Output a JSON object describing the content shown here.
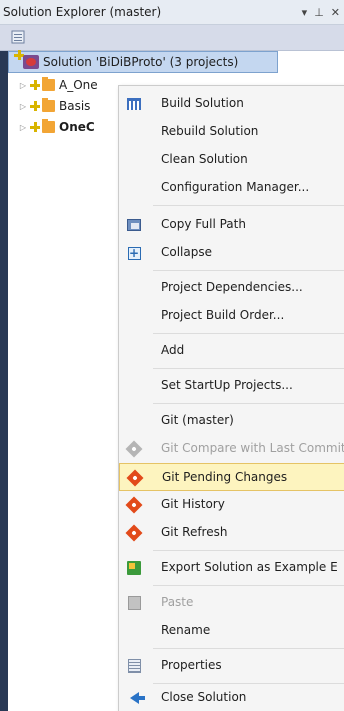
{
  "window": {
    "title": "Solution Explorer (master)",
    "pin_glyph": "▾ ⊥ ✕"
  },
  "toolbar": {
    "icon": "properties-icon"
  },
  "tree": {
    "solution_label": "Solution 'BiDiBProto' (3 projects)",
    "items": [
      {
        "label": "A_One"
      },
      {
        "label": "Basis"
      },
      {
        "label": "OneC"
      }
    ]
  },
  "menu": {
    "items": [
      {
        "label": "Build Solution",
        "icon": "build-icon"
      },
      {
        "label": "Rebuild Solution"
      },
      {
        "label": "Clean Solution"
      },
      {
        "label": "Configuration Manager..."
      },
      {
        "label": "Copy Full Path",
        "icon": "copy-icon"
      },
      {
        "label": "Collapse",
        "icon": "collapse-icon"
      },
      {
        "label": "Project Dependencies..."
      },
      {
        "label": "Project Build Order..."
      },
      {
        "label": "Add"
      },
      {
        "label": "Set StartUp Projects..."
      },
      {
        "label": "Git (master)"
      },
      {
        "label": "Git Compare with Last Commit",
        "icon": "git-diamond-icon"
      },
      {
        "label": "Git Pending Changes",
        "icon": "git-diamond-icon"
      },
      {
        "label": "Git History",
        "icon": "git-diamond-icon"
      },
      {
        "label": "Git Refresh",
        "icon": "git-diamond-icon"
      },
      {
        "label": "Export Solution as Example E",
        "icon": "export-icon"
      },
      {
        "label": "Paste",
        "icon": "paste-icon"
      },
      {
        "label": "Rename"
      },
      {
        "label": "Properties",
        "icon": "properties-icon"
      },
      {
        "label": "Close Solution",
        "icon": "close-solution-icon"
      }
    ]
  },
  "colors": {
    "panel_bg": "#293955",
    "highlight_bg": "#fdf4bf",
    "highlight_border": "#e5c365",
    "git_orange": "#e24a1a"
  }
}
